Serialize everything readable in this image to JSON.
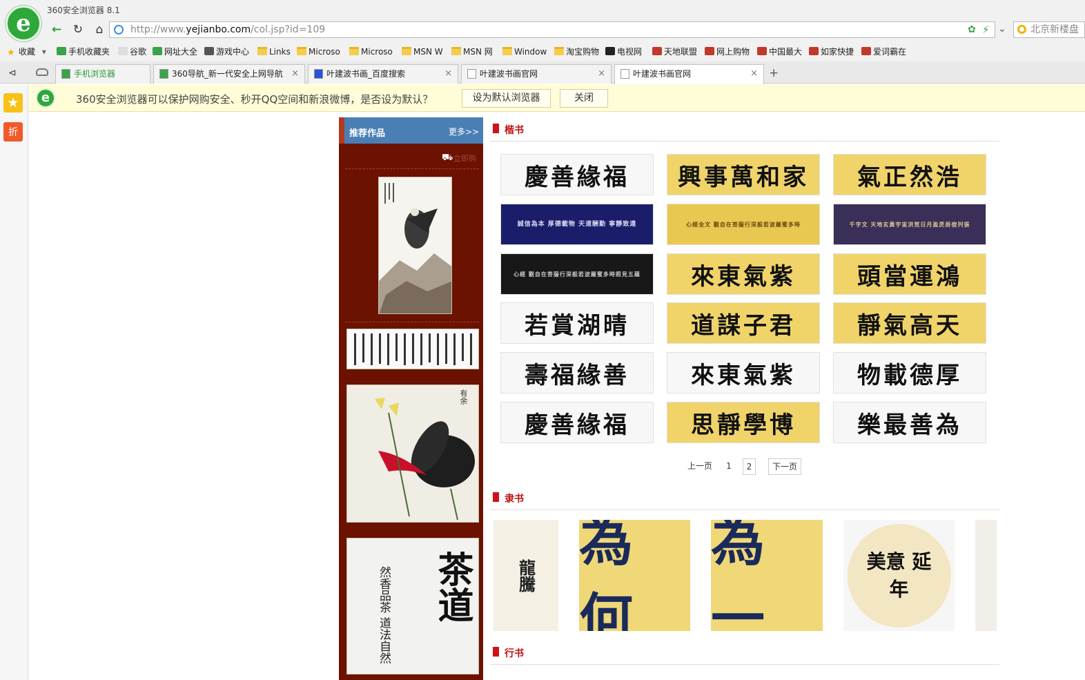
{
  "browser": {
    "title": "360安全浏览器 8.1",
    "logo_letter": "e",
    "url_prefix": "http://www.",
    "url_domain": "yejianbo.com",
    "url_path": "/col.jsp?id=109",
    "search_text": "北京新楼盘",
    "nav": {
      "back": "←",
      "reload": "↻",
      "home": "⌂"
    }
  },
  "bookmarks": [
    {
      "label": "收藏",
      "icon": "star-icon"
    },
    {
      "label": "手机收藏夹",
      "icon": "phone-icon"
    },
    {
      "label": "谷歌",
      "icon": "page-icon"
    },
    {
      "label": "网址大全",
      "icon": "nav-icon"
    },
    {
      "label": "游戏中心",
      "icon": "game-icon"
    },
    {
      "label": "Links",
      "icon": "folder-icon"
    },
    {
      "label": "Microso",
      "icon": "folder-icon"
    },
    {
      "label": "Microso",
      "icon": "folder-icon"
    },
    {
      "label": "MSN W",
      "icon": "folder-icon"
    },
    {
      "label": "MSN 网",
      "icon": "folder-icon"
    },
    {
      "label": "Window",
      "icon": "folder-icon"
    },
    {
      "label": "淘宝购物",
      "icon": "folder-icon"
    },
    {
      "label": "电视网",
      "icon": "tv-icon"
    },
    {
      "label": "天地联盟",
      "icon": "site-icon"
    },
    {
      "label": "网上购物",
      "icon": "shop-icon"
    },
    {
      "label": "中国最大",
      "icon": "site-icon"
    },
    {
      "label": "如家快捷",
      "icon": "site-icon"
    },
    {
      "label": "爱词霸在",
      "icon": "site-icon"
    }
  ],
  "tabs": [
    {
      "label": "手机浏览器",
      "active": false
    },
    {
      "label": "360导航_新一代安全上网导航",
      "active": false
    },
    {
      "label": "叶建波书画_百度搜索",
      "active": false
    },
    {
      "label": "叶建波书画官网",
      "active": false
    },
    {
      "label": "叶建波书画官网",
      "active": true
    }
  ],
  "tab_close": "×",
  "new_tab": "+",
  "notification": {
    "text": "360安全浏览器可以保护网购安全、秒开QQ空间和新浪微博，是否设为默认？",
    "set_default": "设为默认浏览器",
    "close": "关闭"
  },
  "left_bar": {
    "star": "★",
    "discount": "折"
  },
  "sidebar": {
    "title": "推荐作品",
    "more": "更多>>",
    "cart_label": "立即购",
    "tea_big": "茶道",
    "tea_small": "然香品茶 道法自然",
    "fish_title": "有余"
  },
  "sections": [
    {
      "title": "楷书"
    },
    {
      "title": "隶书"
    },
    {
      "title": "行书"
    }
  ],
  "kaishu_works": [
    {
      "text": "慶善緣福",
      "style": "white"
    },
    {
      "text": "興事萬和家",
      "style": "gold"
    },
    {
      "text": "氣正然浩",
      "style": "gold"
    },
    {
      "text": "誠信為本 厚德載物 天道酬勤 寧靜致遠",
      "style": "navy"
    },
    {
      "text": "心經全文 觀自在菩薩行深般若波羅蜜多時",
      "style": "gscroll"
    },
    {
      "text": "千字文 天地玄黃宇宙洪荒日月盈昃辰宿列張",
      "style": "purple"
    },
    {
      "text": "心經 觀自在菩薩行深般若波羅蜜多時照見五蘊",
      "style": "black"
    },
    {
      "text": "來東氣紫",
      "style": "gold"
    },
    {
      "text": "頭當運鴻",
      "style": "gold"
    },
    {
      "text": "若賞湖晴",
      "style": "white"
    },
    {
      "text": "道謀子君",
      "style": "gold"
    },
    {
      "text": "靜氣高天",
      "style": "gold"
    },
    {
      "text": "壽福緣善",
      "style": "white"
    },
    {
      "text": "來東氣紫",
      "style": "white"
    },
    {
      "text": "物載德厚",
      "style": "white"
    },
    {
      "text": "慶善緣福",
      "style": "white"
    },
    {
      "text": "思靜學博",
      "style": "gold"
    },
    {
      "text": "樂最善為",
      "style": "white"
    }
  ],
  "pagination": {
    "prev": "上一页",
    "pages": [
      "1",
      "2"
    ],
    "current": "2",
    "next": "下一页"
  },
  "lishu_works": [
    {
      "text": "龍騰",
      "style": "cream"
    },
    {
      "text": "為 何",
      "style": "gold"
    },
    {
      "text": "為 一",
      "style": "gold"
    },
    {
      "text": "美意 延年",
      "style": "round"
    },
    {
      "text": "",
      "style": "edge"
    }
  ]
}
